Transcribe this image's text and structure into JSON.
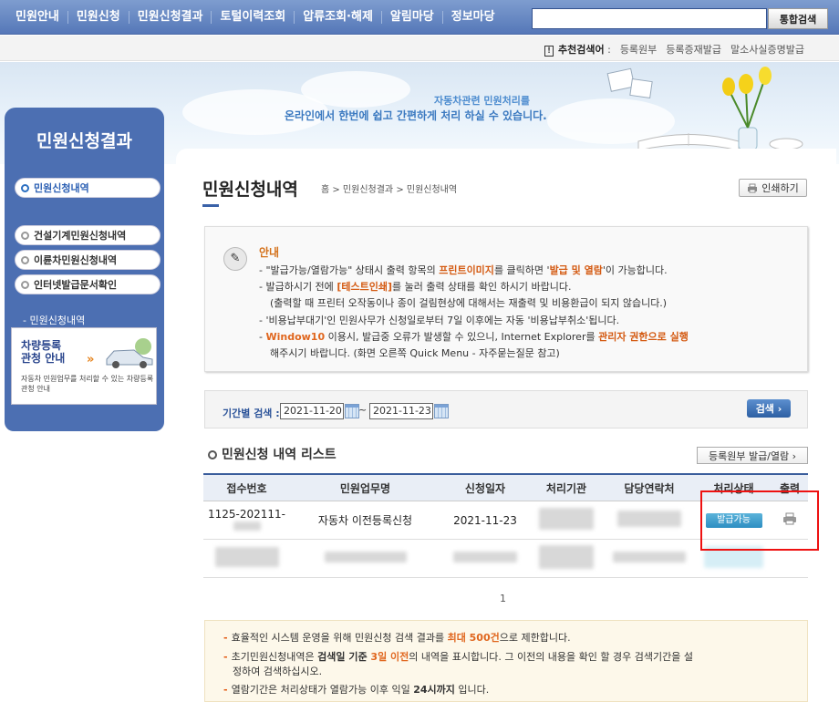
{
  "nav": {
    "items": [
      "민원안내",
      "민원신청",
      "민원신청결과",
      "토털이력조회",
      "압류조회·해제",
      "알림마당",
      "정보마당"
    ],
    "search_button": "통합검색",
    "search_value": ""
  },
  "recommend": {
    "label": "추천검색어",
    "terms": [
      "등록원부",
      "등록증재발급",
      "말소사실증명발급"
    ]
  },
  "banner": {
    "line1": "자동차관련 민원처리를",
    "line2": "온라인에서 한번에 쉽고 간편하게 처리 하실 수 있습니다."
  },
  "sidebar": {
    "title": "민원신청결과",
    "items": [
      "민원신청내역",
      "건설기계민원신청내역",
      "이륜차민원신청내역",
      "인터넷발급문서확인"
    ],
    "sub_item": "민원신청내역",
    "guide_title_1": "차량등록",
    "guide_title_2": "관청 안내",
    "guide_arrow": "»",
    "guide_desc": "자동차 민원업무를 처리할 수 있는 차량등록관청 안내"
  },
  "page": {
    "title": "민원신청내역",
    "breadcrumb": "홈 > 민원신청결과 > 민원신청내역",
    "print_label": "인쇄하기"
  },
  "notice": {
    "head": "안내",
    "l1a": "- \"발급가능/열람가능\" 상태시 출력 항목의 ",
    "l1b": "프린트이미지",
    "l1c": "를 클릭하면 '",
    "l1d": "발급 및 열람",
    "l1e": "'이 가능합니다.",
    "l2a": "- 발급하시기 전에 ",
    "l2b": "[테스트인쇄]",
    "l2c": "를 눌러 출력 상태를 확인 하시기 바랍니다.",
    "l3": "(출력할 때 프린터 오작동이나 종이 걸림현상에 대해서는 재출력 및 비용환급이 되지 않습니다.)",
    "l4": "- '비용납부대기'인 민원사무가 신청일로부터 7일 이후에는 자동 '비용납부취소'됩니다.",
    "l5a": "- ",
    "l5b": "Window10",
    "l5c": " 이용시, 발급중 오류가 발생할 수 있으니, Internet Explorer를 ",
    "l5d": "관리자 권한으로 실행",
    "l6": "해주시기 바랍니다. (화면 오른쪽 Quick Menu - 자주묻는질문 참고)"
  },
  "date_search": {
    "label": "기간별 검색 :",
    "from": "2021-11-20",
    "to": "2021-11-23",
    "tilde": "~",
    "button": "검색 ›"
  },
  "list": {
    "title": "민원신청 내역 리스트",
    "reg_button": "등록원부 발급/열람  ›",
    "headers": [
      "접수번호",
      "민원업무명",
      "신청일자",
      "처리기관",
      "담당연락처",
      "처리상태",
      "출력"
    ],
    "row1": {
      "receipt": "1125-202111-",
      "task": "자동차 이전등록신청",
      "date": "2021-11-23",
      "status": "발급가능"
    },
    "page": "1"
  },
  "bottom": {
    "l1a": "효율적인 시스템 운영을 위해 민원신청 검색 결과를 ",
    "l1b": "최대 500건",
    "l1c": "으로 제한합니다.",
    "l2a": "초기민원신청내역은 ",
    "l2b": "검색일 기준 ",
    "l2c": "3일 이전",
    "l2d": "의 내역을 표시합니다. 그 이전의 내용을 확인 할 경우 검색기간을 설",
    "l2e": "정하여 검색하십시오.",
    "l3a": "열람기간은 처리상태가 열람가능 이후 익일 ",
    "l3b": "24시까지",
    "l3c": " 입니다."
  }
}
